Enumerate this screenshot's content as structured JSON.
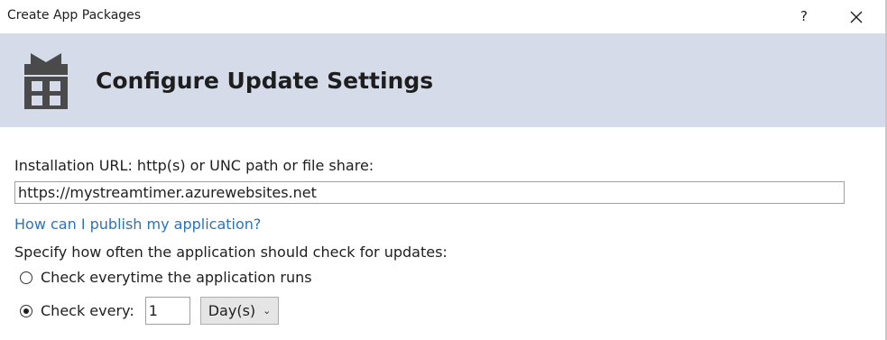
{
  "window": {
    "title": "Create App Packages",
    "help_label": "?"
  },
  "header": {
    "title": "Configure Update Settings",
    "icon": "gift-package-icon"
  },
  "form": {
    "url_label": "Installation URL: http(s) or UNC path or file share:",
    "url_value": "https://mystreamtimer.azurewebsites.net",
    "publish_link": "How can I publish my application?",
    "frequency_label": "Specify how often the application should check for updates:",
    "option_everytime": "Check everytime the application runs",
    "option_every": "Check every:",
    "interval_value": "1",
    "interval_unit": "Day(s)",
    "selected_option": "every"
  },
  "colors": {
    "header_band": "#d5dbe8",
    "link": "#2a74b8",
    "icon_gray": "#4a4a4a"
  }
}
